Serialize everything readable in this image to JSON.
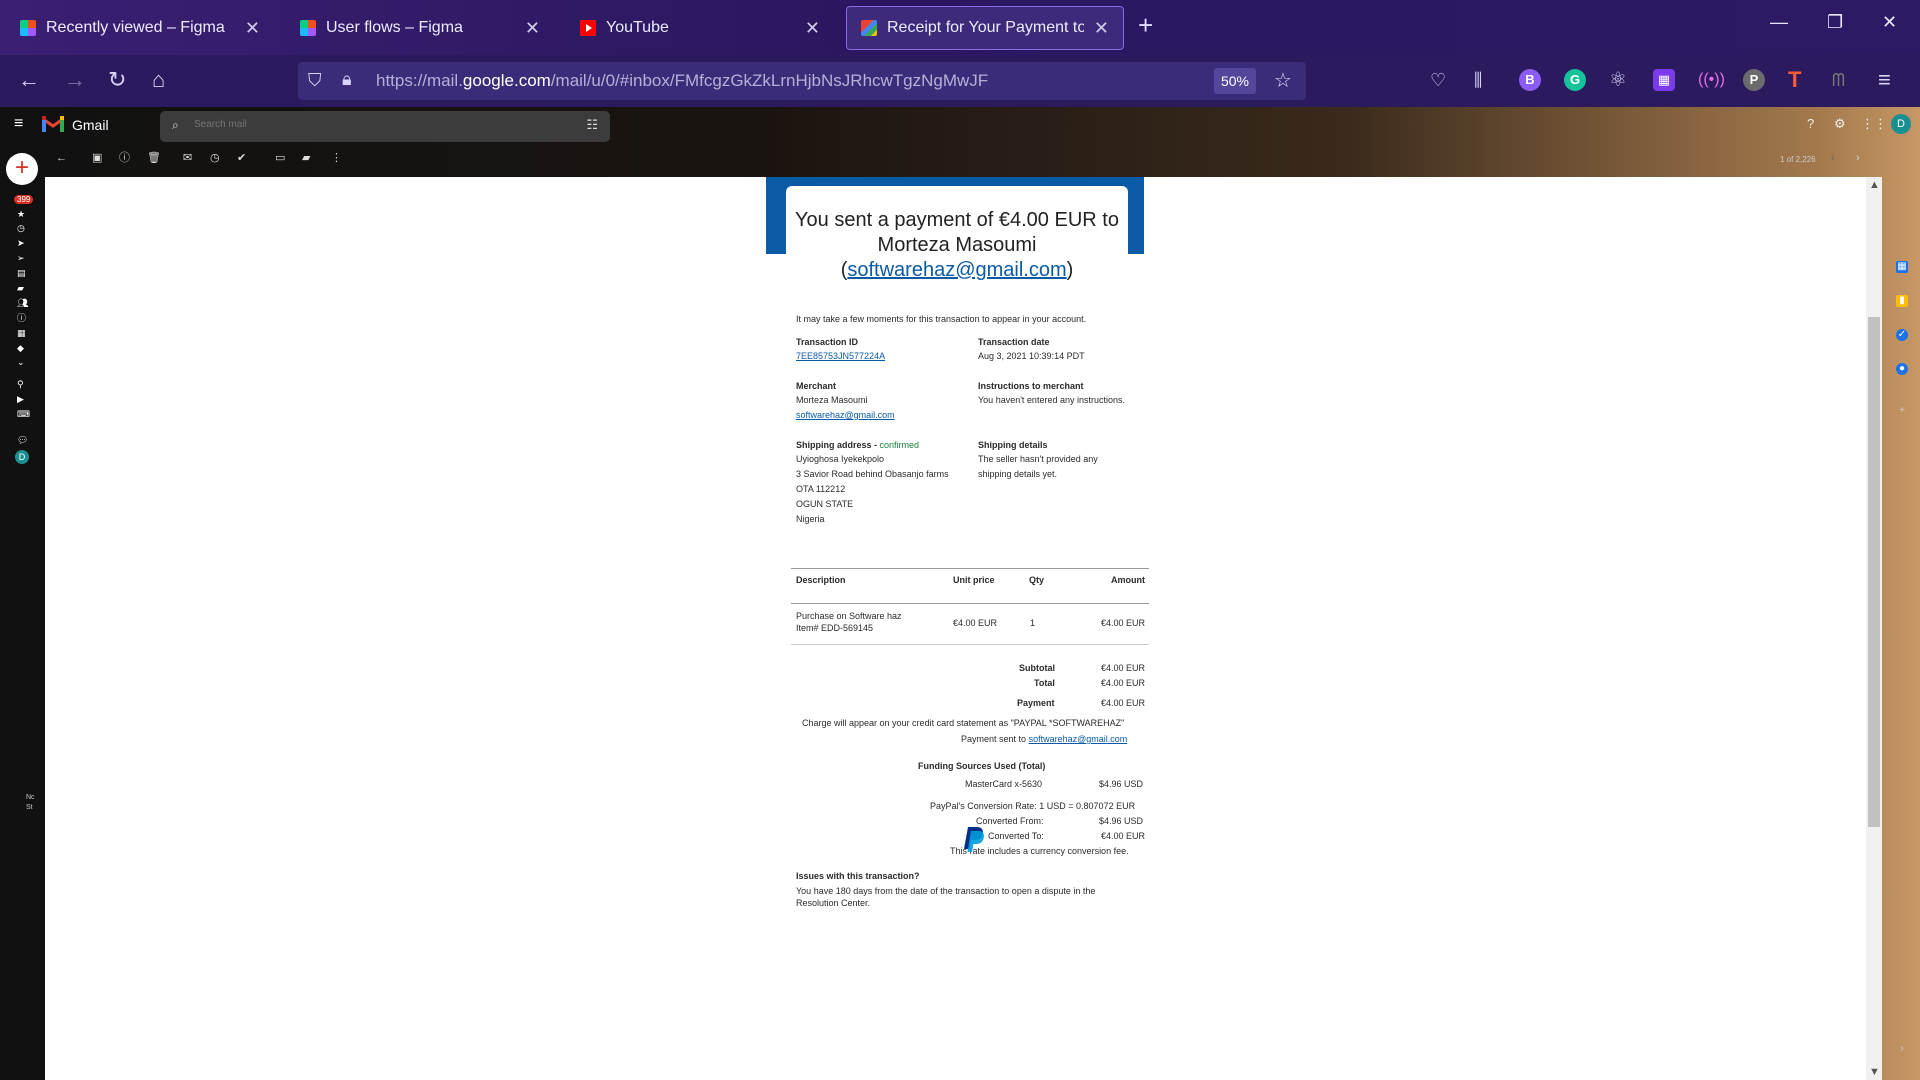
{
  "browser": {
    "tabs": [
      {
        "title": "Recently viewed – Figma",
        "active": false
      },
      {
        "title": "User flows – Figma",
        "active": false
      },
      {
        "title": "YouTube",
        "active": false
      },
      {
        "title": "Receipt for Your Payment to Mo",
        "active": true
      }
    ],
    "url_prefix": "https://mail.",
    "url_domain": "google.com",
    "url_path": "/mail/u/0/#inbox/FMfcgzGkZkLrnHjbNsJRhcwTgzNgMwJF",
    "zoom": "50%",
    "ext_b": "B",
    "ext_g": "G",
    "ext_t": "T"
  },
  "gmail": {
    "app_name": "Gmail",
    "search_placeholder": "Search mail",
    "avatar_letter": "D",
    "unread_badge": "399",
    "pager": "1 of 2,226",
    "rail_avatar": "D",
    "side_text_1": "Nc",
    "side_text_2": "St"
  },
  "email": {
    "headline_pre": "You sent a payment of €4.00 EUR to Morteza Masoumi (",
    "headline_link": "softwarehaz@gmail.com",
    "headline_post": ")",
    "intro": "It may take a few moments for this transaction to appear in your account.",
    "txn_id_label": "Transaction ID",
    "txn_id": "7EE85753JN577224A",
    "txn_date_label": "Transaction date",
    "txn_date": "Aug 3, 2021 10:39:14 PDT",
    "merchant_label": "Merchant",
    "merchant_name": "Morteza Masoumi",
    "merchant_email": "softwarehaz@gmail.com",
    "instructions_label": "Instructions to merchant",
    "instructions": "You haven't entered any instructions.",
    "shipping_label": "Shipping address -",
    "shipping_status": "confirmed",
    "shipping_lines": [
      "Uyioghosa Iyekekpolo",
      "3 Savior Road behind Obasanjo farms",
      "OTA 112212",
      "OGUN STATE",
      "Nigeria"
    ],
    "shipping_details_label": "Shipping details",
    "shipping_details": [
      "The seller hasn't provided any",
      "shipping details yet."
    ],
    "table_headers": {
      "description": "Description",
      "unit_price": "Unit price",
      "qty": "Qty",
      "amount": "Amount"
    },
    "items": [
      {
        "desc1": "Purchase on Software haz",
        "desc2": "Item# EDD-569145",
        "unit_price": "€4.00 EUR",
        "qty": "1",
        "amount": "€4.00 EUR"
      }
    ],
    "subtotal_label": "Subtotal",
    "subtotal": "€4.00 EUR",
    "total_label": "Total",
    "total": "€4.00 EUR",
    "payment_label": "Payment",
    "payment": "€4.00 EUR",
    "charge_note": "Charge will appear on your credit card statement as \"PAYPAL *SOFTWAREHAZ\"",
    "payment_sent_to": "Payment sent to",
    "payment_sent_email": "softwarehaz@gmail.com",
    "funding_title": "Funding Sources Used (Total)",
    "funding_source": "MasterCard x-5630",
    "funding_amount": "$4.96 USD",
    "conversion_rate": "PayPal's Conversion Rate: 1 USD = 0.807072 EUR",
    "converted_from_label": "Converted From:",
    "converted_from": "$4.96 USD",
    "converted_to_label": "Converted To:",
    "converted_to": "€4.00 EUR",
    "fee_note": "This rate includes a currency conversion fee.",
    "issues_title": "Issues with this transaction?",
    "issues_line1": "You have 180 days from the date of the transaction to open a dispute in the",
    "issues_line2": "Resolution Center.",
    "brand_color": "#0a5aa6"
  }
}
